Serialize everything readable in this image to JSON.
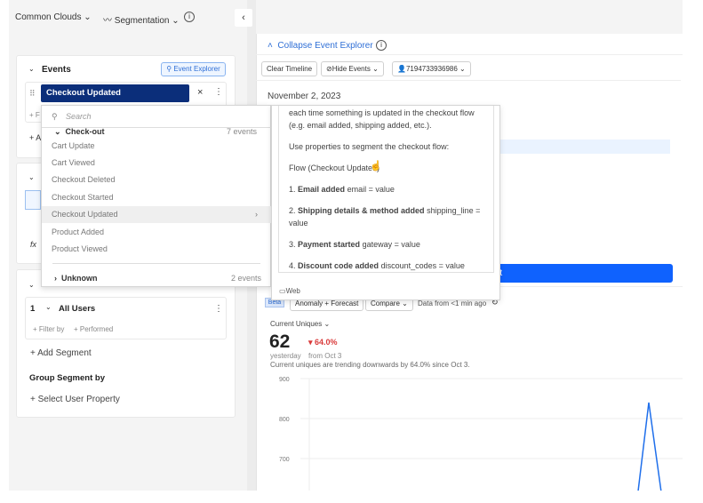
{
  "topbar": {
    "project": "Common Clouds",
    "chart_type": "Segmentation"
  },
  "events_card": {
    "title": "Events",
    "explorer_button": "Event Explorer",
    "selected_event": "Checkout Updated",
    "filter_stub": "+ F",
    "add_stub": "+ A"
  },
  "formula_label": "fx",
  "dropdown": {
    "search_placeholder": "Search",
    "groups": [
      {
        "name": "Check-out",
        "count": "7 events"
      },
      {
        "name": "Unknown",
        "count": "2 events"
      }
    ],
    "items": [
      "Cart Update",
      "Cart Viewed",
      "Checkout Deleted",
      "Checkout Started",
      "Checkout Updated",
      "Product Added",
      "Product Viewed"
    ],
    "highlighted": "Checkout Updated"
  },
  "description": {
    "intro": "each time something is updated in the checkout flow (e.g. email added, shipping added, etc.).",
    "segment_hint": "Use properties to segment the checkout flow:",
    "flow_title": "Flow (Checkout Updated)",
    "steps": [
      {
        "num": "1.",
        "name": "Email added",
        "prop": "email = value"
      },
      {
        "num": "2.",
        "name": "Shipping details & method added",
        "prop": "shipping_line = value"
      },
      {
        "num": "3.",
        "name": "Payment started",
        "prop": "gateway = value"
      },
      {
        "num": "4.",
        "name": "Discount code added",
        "prop": "discount_codes = value"
      }
    ],
    "platform": "Web"
  },
  "segments": {
    "segment_number": "1",
    "segment_name": "All Users",
    "filter_by": "+ Filter by",
    "performed": "+ Performed",
    "add_segment": "+ Add Segment",
    "group_title": "Group Segment by",
    "select_property": "+ Select User Property"
  },
  "explorer": {
    "collapse": "Collapse Event Explorer",
    "clear": "Clear Timeline",
    "hide": "Hide Events",
    "user_id": "7194733936986",
    "date": "November 2, 2023",
    "start_button_fragment": "rt"
  },
  "chart_toolbar": {
    "beta": "Beta",
    "anomaly": "Anomaly + Forecast",
    "compare": "Compare",
    "data_age": "Data from <1 min ago"
  },
  "metric": {
    "label": "Current Uniques",
    "value": "62",
    "value_sub": "yesterday",
    "change": "64.0%",
    "change_sub": "from Oct 3",
    "summary": "Current uniques are trending downwards by 64.0% since Oct 3.",
    "change_color": "#d93a3a"
  },
  "chart_data": {
    "type": "line",
    "y_ticks": [
      "900",
      "800",
      "700"
    ],
    "ylim_visible": [
      620,
      900
    ],
    "series": [
      {
        "values": [
          600,
          600,
          840,
          600
        ]
      }
    ],
    "grid": true,
    "color": "#1f6feb"
  },
  "colors": {
    "accent": "#0f62fe",
    "selected_event_bg": "#0b2e7a",
    "link": "#2f6fd6"
  }
}
